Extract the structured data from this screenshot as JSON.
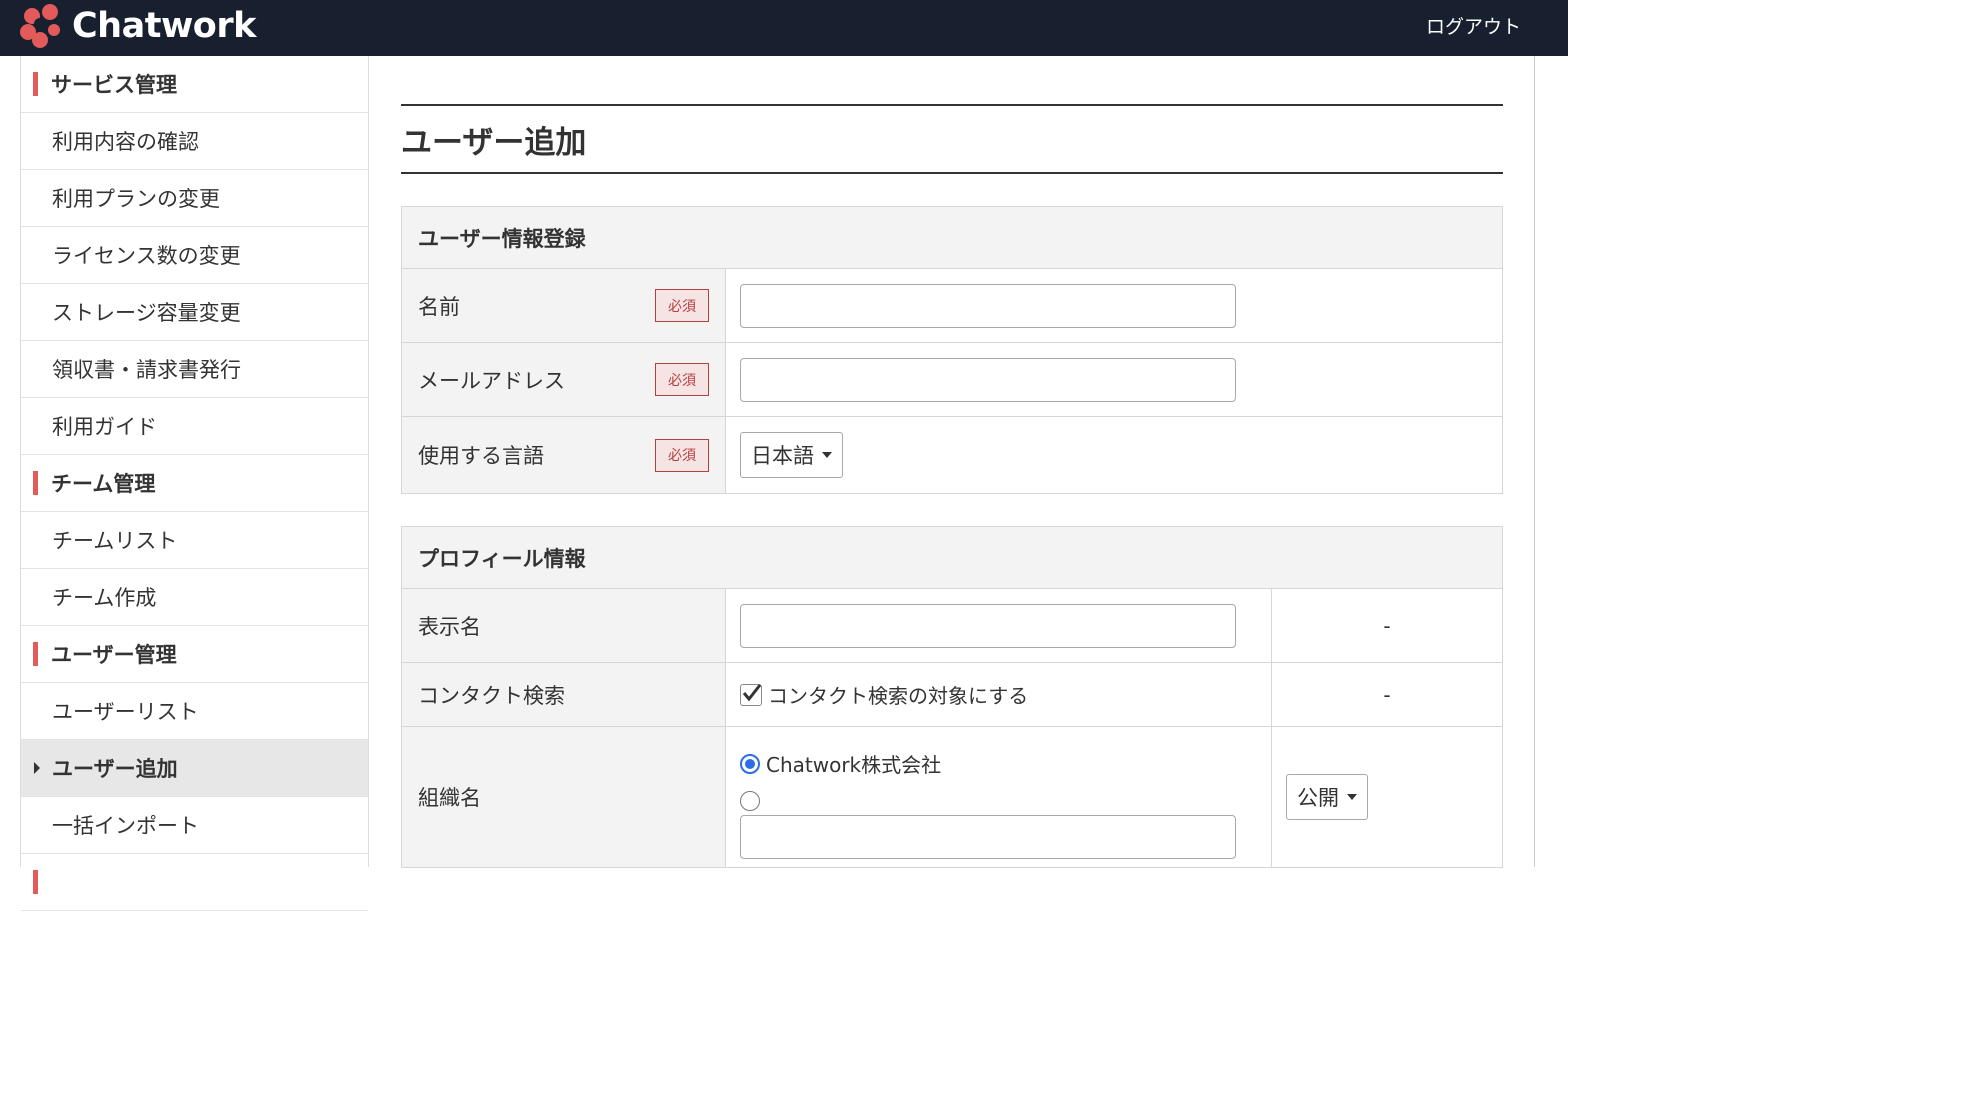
{
  "header": {
    "brand": "Chatwork",
    "logout": "ログアウト"
  },
  "sidebar": {
    "items": [
      {
        "label": "サービス管理",
        "kind": "section"
      },
      {
        "label": "利用内容の確認",
        "kind": "item"
      },
      {
        "label": "利用プランの変更",
        "kind": "item"
      },
      {
        "label": "ライセンス数の変更",
        "kind": "item"
      },
      {
        "label": "ストレージ容量変更",
        "kind": "item"
      },
      {
        "label": "領収書・請求書発行",
        "kind": "item"
      },
      {
        "label": "利用ガイド",
        "kind": "item"
      },
      {
        "label": "チーム管理",
        "kind": "section"
      },
      {
        "label": "チームリスト",
        "kind": "item"
      },
      {
        "label": "チーム作成",
        "kind": "item"
      },
      {
        "label": "ユーザー管理",
        "kind": "section"
      },
      {
        "label": "ユーザーリスト",
        "kind": "item"
      },
      {
        "label": "ユーザー追加",
        "kind": "active"
      },
      {
        "label": "一括インポート",
        "kind": "item"
      }
    ]
  },
  "main": {
    "title": "ユーザー追加",
    "registration": {
      "heading": "ユーザー情報登録",
      "required_label": "必須",
      "name_label": "名前",
      "email_label": "メールアドレス",
      "language_label": "使用する言語",
      "language_value": "日本語"
    },
    "profile": {
      "heading": "プロフィール情報",
      "display_name_label": "表示名",
      "display_name_note": "-",
      "contact_label": "コンタクト検索",
      "contact_checkbox_label": "コンタクト検索の対象にする",
      "contact_checked": true,
      "contact_note": "-",
      "org_label": "組織名",
      "org_option_1": "Chatwork株式会社",
      "org_visibility": "公開"
    }
  },
  "colors": {
    "header_bg": "#18202f",
    "accent_red": "#e25a5a",
    "radio_blue": "#2a6de6"
  }
}
